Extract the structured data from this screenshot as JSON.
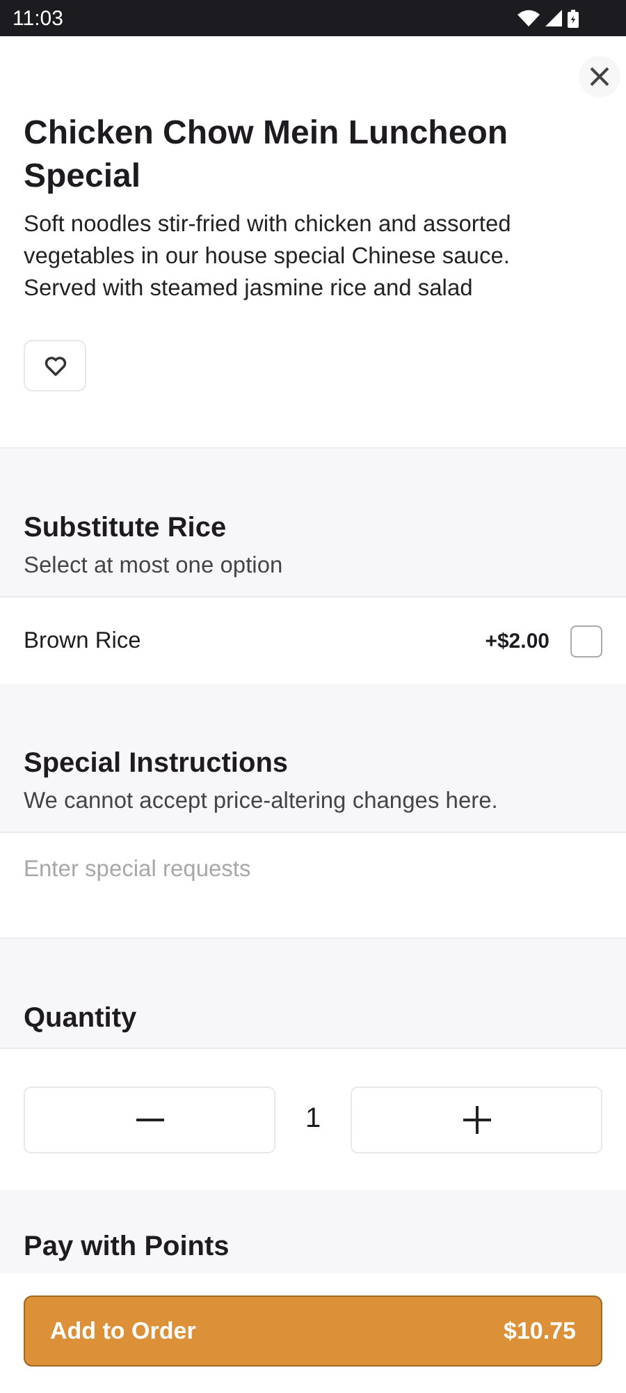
{
  "status_bar": {
    "time": "11:03"
  },
  "item": {
    "title": "Chicken Chow Mein Luncheon Special",
    "description": "Soft noodles stir-fried with chicken and assorted vegetables in our house special Chinese sauce. Served with steamed jasmine rice and salad",
    "favorite": false
  },
  "option_groups": [
    {
      "title": "Substitute Rice",
      "subtitle": "Select at most one option",
      "options": [
        {
          "label": "Brown Rice",
          "price": "+$2.00",
          "checked": false
        }
      ]
    }
  ],
  "special_instructions": {
    "title": "Special Instructions",
    "subtitle": "We cannot accept price-altering changes here.",
    "placeholder": "Enter special requests"
  },
  "quantity": {
    "title": "Quantity",
    "value": "1"
  },
  "points": {
    "title": "Pay with Points"
  },
  "footer": {
    "button": "Add to Order",
    "total": "$10.75"
  }
}
